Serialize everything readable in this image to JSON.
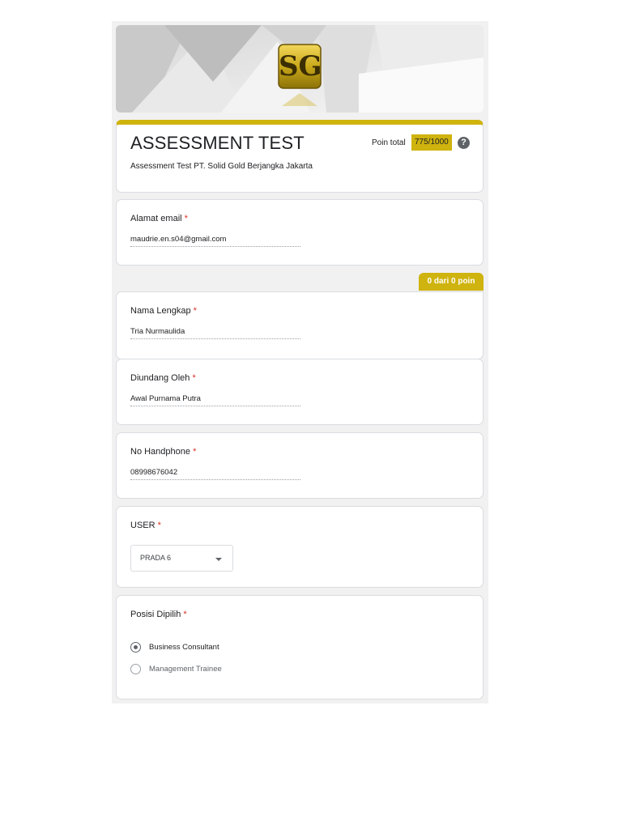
{
  "header": {
    "logo_text": "SG",
    "title": "ASSESSMENT TEST",
    "description": "Assessment Test PT. Solid Gold Berjangka Jakarta",
    "points_label": "Poin total",
    "points_value": "775/1000",
    "help_icon": "question-circle-icon"
  },
  "section": {
    "score_tab": "0 dari 0 poin"
  },
  "questions": [
    {
      "label": "Alamat email",
      "required": "*",
      "answer": "maudrie.en.s04@gmail.com"
    },
    {
      "label": "Nama Lengkap",
      "required": "*",
      "answer": "Tria Nurmaulida"
    },
    {
      "label": "Diundang Oleh",
      "required": "*",
      "answer": "Awal Purnama Putra"
    },
    {
      "label": "No Handphone",
      "required": "*",
      "answer": "08998676042"
    }
  ],
  "user": {
    "label": "USER",
    "required": "*",
    "selected": "PRADA 6"
  },
  "posisi": {
    "label": "Posisi Dipilih",
    "required": "*",
    "options": [
      {
        "label": "Business Consultant",
        "checked": true
      },
      {
        "label": "Management Trainee",
        "checked": false
      }
    ]
  },
  "colors": {
    "accent": "#cfb30e",
    "required": "#d93025"
  }
}
